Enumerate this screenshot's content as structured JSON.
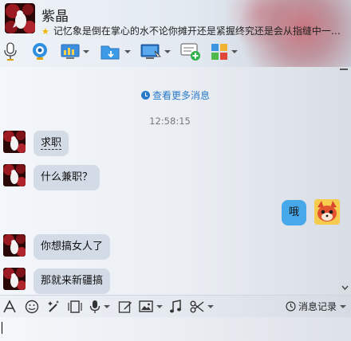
{
  "header": {
    "contact_name": "紫晶",
    "signature": "记忆象是倒在掌心的水不论你摊开还是紧握终究还是会从指缝中一…"
  },
  "toolbar": {
    "items": [
      {
        "icon": "microphone-icon"
      },
      {
        "icon": "webcam-icon"
      },
      {
        "icon": "remote-assist-icon"
      },
      {
        "icon": "file-transfer-icon"
      },
      {
        "icon": "screen-share-icon"
      },
      {
        "icon": "new-message-icon"
      },
      {
        "icon": "apps-icon"
      }
    ]
  },
  "chat": {
    "more_messages": "查看更多消息",
    "timestamp": "12:58:15",
    "messages": [
      {
        "side": "left",
        "text": "求职"
      },
      {
        "side": "left",
        "text": "什么兼职？"
      },
      {
        "side": "right",
        "text": "哦"
      },
      {
        "side": "left",
        "text": "你想搞女人了"
      },
      {
        "side": "left",
        "text": "那就来新疆搞"
      }
    ]
  },
  "input_toolbar": {
    "history_label": "消息记录"
  },
  "colors": {
    "link_blue": "#2a7ac9",
    "bubble_left": "#d3dbe6",
    "bubble_right": "#47a9e9"
  }
}
